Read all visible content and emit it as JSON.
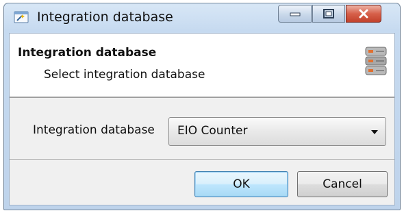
{
  "window": {
    "title": "Integration database",
    "app_icon": "wizard-icon",
    "controls": {
      "minimize": "minimize-icon",
      "maximize": "maximize-icon",
      "close": "close-icon"
    }
  },
  "header": {
    "title": "Integration database",
    "subtitle": "Select integration database",
    "icon": "database-icon"
  },
  "form": {
    "label": "Integration database",
    "selected_value": "EIO Counter"
  },
  "buttons": {
    "ok": "OK",
    "cancel": "Cancel"
  },
  "colors": {
    "frame": "#c6daf0",
    "close_button": "#c2412b",
    "default_button_border": "#3c7fb1"
  }
}
